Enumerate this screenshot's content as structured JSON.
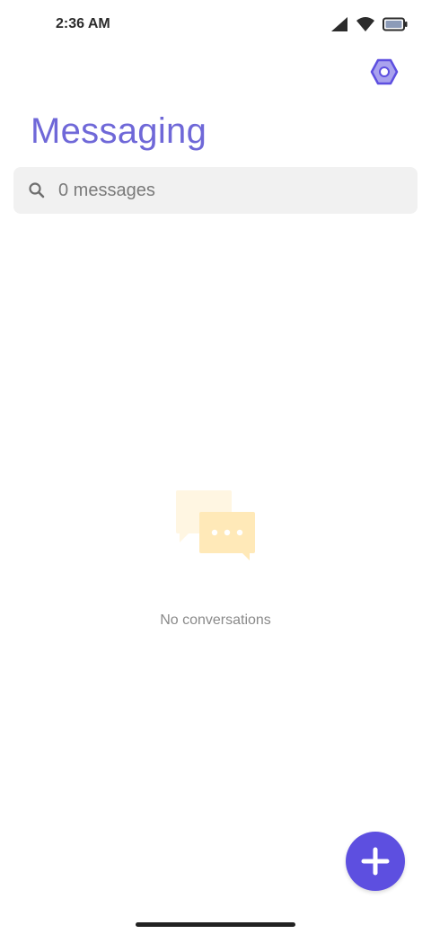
{
  "status_bar": {
    "time": "2:36 AM",
    "icons": [
      "signal-icon",
      "wifi-icon",
      "battery-icon"
    ]
  },
  "header": {
    "title": "Messaging",
    "settings_icon": "settings-hexagon-icon",
    "accent_color": "#6f68d8"
  },
  "search": {
    "placeholder": "0 messages",
    "value": "",
    "icon": "search-icon"
  },
  "empty_state": {
    "illustration": "chat-bubbles-icon",
    "message": "No conversations"
  },
  "fab": {
    "icon": "plus-icon",
    "color": "#5d4fe0"
  }
}
